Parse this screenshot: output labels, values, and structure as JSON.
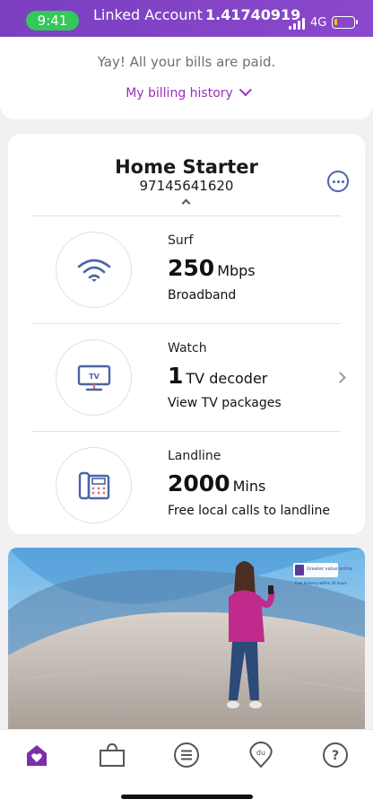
{
  "status_bar": {
    "time": "9:41",
    "linked_label": "Linked Account",
    "linked_number": "1.41740919",
    "network": "4G",
    "battery_level": 0.15
  },
  "bills": {
    "message": "Yay! All your bills are paid.",
    "history_link": "My billing history"
  },
  "plan": {
    "title": "Home Starter",
    "number": "97145641620",
    "rows": [
      {
        "label": "Surf",
        "value": "250",
        "unit": "Mbps",
        "sub": "Broadband",
        "icon": "wifi-icon"
      },
      {
        "label": "Watch",
        "value": "1",
        "unit": "TV decoder",
        "sub": "View TV packages",
        "icon": "tv-icon"
      },
      {
        "label": "Landline",
        "value": "2000",
        "unit": "Mins",
        "sub": "Free local calls to landline",
        "icon": "desk-phone-icon"
      }
    ]
  },
  "promo": {
    "badge_title": "Greater value online",
    "badge_sub": "Free delivery within 24 hours"
  },
  "bottom_nav": {
    "items": [
      "home-heart-icon",
      "shopping-bag-icon",
      "menu-icon",
      "du-location-icon",
      "help-icon"
    ]
  },
  "colors": {
    "brand": "#8a48cc",
    "accent": "#9b30b8",
    "icon_blue": "#4a64a8"
  }
}
